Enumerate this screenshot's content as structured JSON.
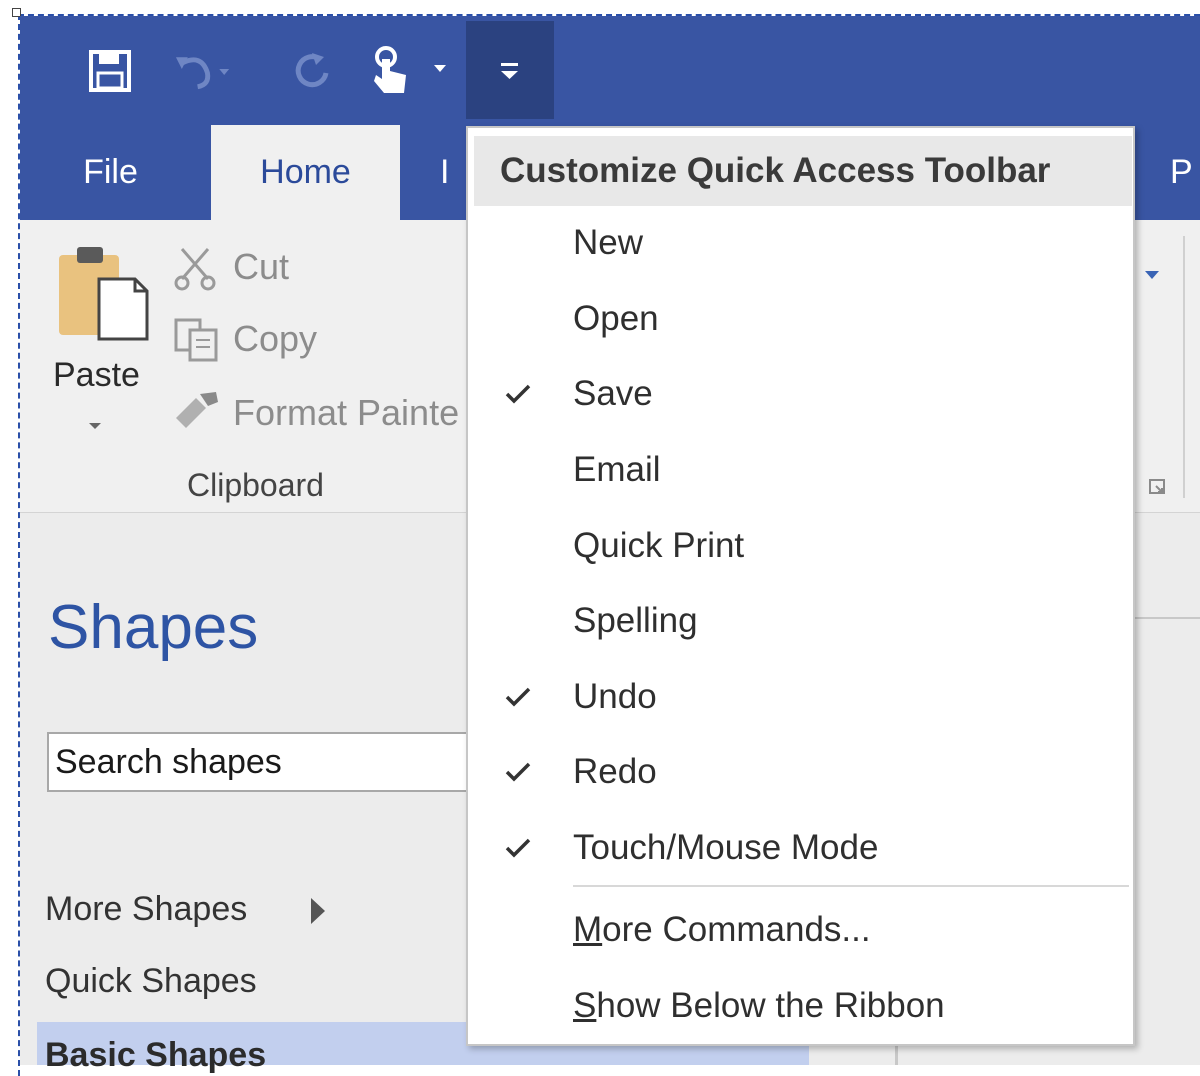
{
  "colors": {
    "brand": "#3955a3",
    "customize_active": "#2b4280",
    "accent_text": "#2e54a4",
    "selected_stencil": "#c2cfee"
  },
  "qat": {
    "icons": [
      "save-icon",
      "undo-icon",
      "redo-icon",
      "touch-mode-icon",
      "customize-dropdown-icon"
    ]
  },
  "tabs": [
    {
      "label": "File"
    },
    {
      "label": "Home"
    },
    {
      "label": "I"
    },
    {
      "label": "P"
    }
  ],
  "ribbon": {
    "paste_label": "Paste",
    "cut_label": "Cut",
    "copy_label": "Copy",
    "format_painter_label": "Format Painte",
    "clipboard_group": "Clipboard"
  },
  "shapes_pane": {
    "title": "Shapes",
    "search_value": "Search shapes",
    "more_shapes": "More Shapes",
    "quick_shapes": "Quick Shapes",
    "basic_shapes": "Basic Shapes"
  },
  "menu": {
    "header": "Customize Quick Access Toolbar",
    "items": [
      {
        "label": "New",
        "checked": false
      },
      {
        "label": "Open",
        "checked": false
      },
      {
        "label": "Save",
        "checked": true
      },
      {
        "label": "Email",
        "checked": false
      },
      {
        "label": "Quick Print",
        "checked": false
      },
      {
        "label": "Spelling",
        "checked": false
      },
      {
        "label": "Undo",
        "checked": true
      },
      {
        "label": "Redo",
        "checked": true
      },
      {
        "label": "Touch/Mouse Mode",
        "checked": true
      }
    ],
    "more_commands": {
      "prefix": "M",
      "rest": "ore Commands..."
    },
    "show_below": {
      "prefix": "S",
      "rest": "how Below the Ribbon"
    }
  }
}
